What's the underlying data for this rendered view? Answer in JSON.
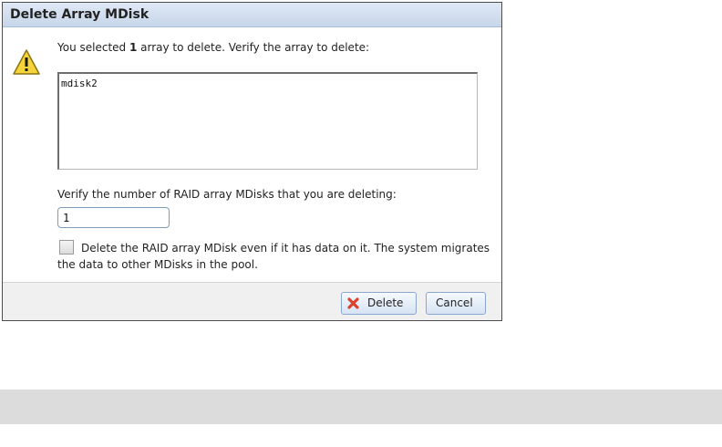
{
  "dialog": {
    "title": "Delete Array MDisk",
    "message_prefix": "You selected ",
    "message_count": "1",
    "message_suffix": " array to delete. Verify the array to delete:",
    "arrays": [
      "mdisk2"
    ],
    "verify_label": "Verify the number of RAID array MDisks that you are deleting:",
    "verify_value": "1",
    "checkbox_checked": false,
    "checkbox_label": "Delete the RAID array MDisk even if it has data on it. The system migrates the data to other MDisks in the pool.",
    "buttons": {
      "delete_label": "Delete",
      "cancel_label": "Cancel"
    },
    "icons": {
      "warning": "warning-icon",
      "delete": "delete-x-icon"
    }
  },
  "colors": {
    "titlebar": "#c7d6ea",
    "warning_yellow": "#f5d33a",
    "delete_red": "#d9432f",
    "button_border": "#8aa7cf"
  }
}
